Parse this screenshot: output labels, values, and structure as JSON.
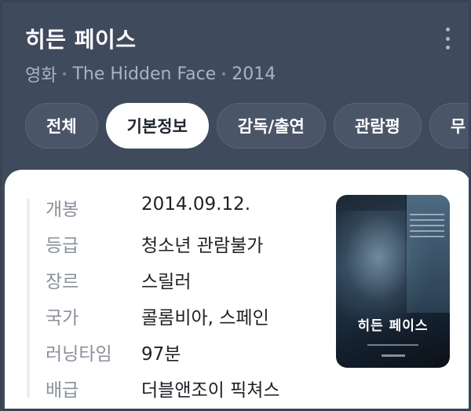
{
  "header": {
    "title": "히든 페이스",
    "subtitle": [
      "영화",
      "The Hidden Face",
      "2014"
    ]
  },
  "tabs": [
    {
      "label": "전체",
      "active": false
    },
    {
      "label": "기본정보",
      "active": true
    },
    {
      "label": "감독/출연",
      "active": false
    },
    {
      "label": "관람평",
      "active": false
    },
    {
      "label": "무",
      "active": false
    }
  ],
  "info": [
    {
      "label": "개봉",
      "value": "2014.09.12."
    },
    {
      "label": "등급",
      "value": "청소년 관람불가"
    },
    {
      "label": "장르",
      "value": "스릴러"
    },
    {
      "label": "국가",
      "value": "콜롬비아, 스페인"
    },
    {
      "label": "러닝타임",
      "value": "97분"
    },
    {
      "label": "배급",
      "value": "더블앤조이 픽쳐스"
    }
  ],
  "poster": {
    "title": "히든 페이스"
  },
  "icons": {
    "more": "more-vertical-icon"
  },
  "colors": {
    "background": "#3f4a5c",
    "tab_active": "#ffffff",
    "card": "#ffffff"
  }
}
